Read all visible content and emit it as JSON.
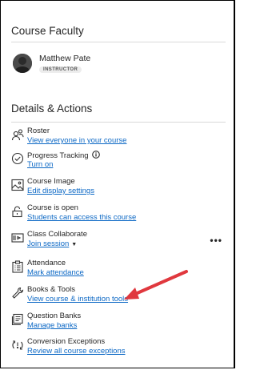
{
  "faculty": {
    "title": "Course Faculty",
    "name": "Matthew Pate",
    "role": "INSTRUCTOR"
  },
  "details": {
    "title": "Details & Actions",
    "items": [
      {
        "title": "Roster",
        "link": "View everyone in your course",
        "icon": "roster-icon"
      },
      {
        "title": "Progress Tracking",
        "link": "Turn on",
        "icon": "progress-check-icon"
      },
      {
        "title": "Course Image",
        "link": "Edit display settings",
        "icon": "image-icon"
      },
      {
        "title": "Course is open",
        "link": "Students can access this course",
        "icon": "unlock-icon"
      },
      {
        "title": "Class Collaborate",
        "link": "Join session",
        "icon": "collaborate-icon"
      },
      {
        "title": "Attendance",
        "link": "Mark attendance",
        "icon": "attendance-icon"
      },
      {
        "title": "Books & Tools",
        "link": "View course & institution tools",
        "icon": "tools-icon"
      },
      {
        "title": "Question Banks",
        "link": "Manage banks",
        "icon": "question-bank-icon"
      },
      {
        "title": "Conversion Exceptions",
        "link": "Review all course exceptions",
        "icon": "conversion-icon"
      }
    ]
  },
  "colors": {
    "link": "#0c68c5",
    "arrow": "#e0383e"
  }
}
